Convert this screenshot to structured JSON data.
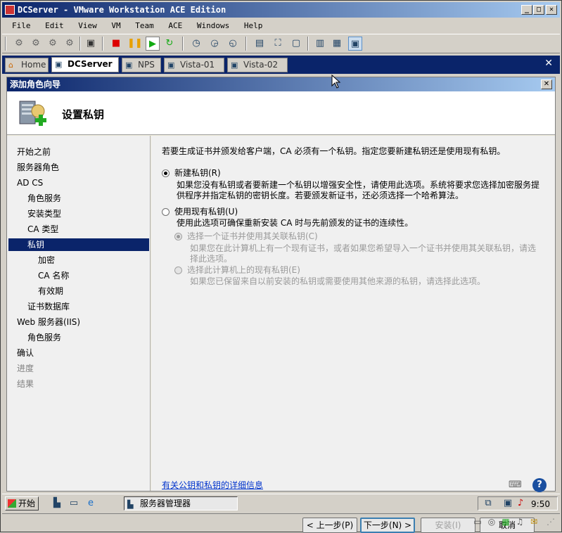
{
  "window": {
    "title": "DCServer - VMware Workstation ACE Edition",
    "minimize": "_",
    "maximize": "□",
    "close": "✕"
  },
  "menu": [
    "File",
    "Edit",
    "View",
    "VM",
    "Team",
    "ACE",
    "Windows",
    "Help"
  ],
  "tabs": [
    {
      "label": "Home",
      "icon": "home-icon"
    },
    {
      "label": "DCServer",
      "icon": "vm-icon",
      "active": true
    },
    {
      "label": "NPS",
      "icon": "vm-icon"
    },
    {
      "label": "Vista-01",
      "icon": "vm-icon"
    },
    {
      "label": "Vista-02",
      "icon": "vm-icon"
    }
  ],
  "tabs_close": "✕",
  "dialog": {
    "title": "添加角色向导",
    "close": "✕",
    "heading": "设置私钥",
    "nav": [
      {
        "label": "开始之前",
        "level": 0,
        "state": "normal"
      },
      {
        "label": "服务器角色",
        "level": 0,
        "state": "normal"
      },
      {
        "label": "AD CS",
        "level": 0,
        "state": "normal"
      },
      {
        "label": "角色服务",
        "level": 1,
        "state": "normal"
      },
      {
        "label": "安装类型",
        "level": 1,
        "state": "normal"
      },
      {
        "label": "CA 类型",
        "level": 1,
        "state": "normal"
      },
      {
        "label": "私钥",
        "level": 1,
        "state": "selected"
      },
      {
        "label": "加密",
        "level": 2,
        "state": "normal"
      },
      {
        "label": "CA 名称",
        "level": 2,
        "state": "normal"
      },
      {
        "label": "有效期",
        "level": 2,
        "state": "normal"
      },
      {
        "label": "证书数据库",
        "level": 1,
        "state": "normal"
      },
      {
        "label": "Web 服务器(IIS)",
        "level": 0,
        "state": "normal"
      },
      {
        "label": "角色服务",
        "level": 1,
        "state": "normal"
      },
      {
        "label": "确认",
        "level": 0,
        "state": "normal"
      },
      {
        "label": "进度",
        "level": 0,
        "state": "disabled"
      },
      {
        "label": "结果",
        "level": 0,
        "state": "disabled"
      }
    ],
    "intro": "若要生成证书并颁发给客户端，CA 必须有一个私钥。指定您要新建私钥还是使用现有私钥。",
    "opt_new_label": "新建私钥(R)",
    "opt_new_desc_1": "如果您没有私钥或者要新建一个私钥以增强安全性，请使用此选项。系统将要求您选择加密服务提",
    "opt_new_desc_2": "供程序并指定私钥的密钥长度。若要颁发新证书，还必须选择一个哈希算法。",
    "opt_existing_label": "使用现有私钥(U)",
    "opt_existing_desc": "使用此选项可确保重新安装 CA 时与先前颁发的证书的连续性。",
    "sub_cert_label": "选择一个证书并使用其关联私钥(C)",
    "sub_cert_desc_1": "如果您在此计算机上有一个现有证书，或者如果您希望导入一个证书并使用其关联私钥，请选",
    "sub_cert_desc_2": "择此选项。",
    "sub_key_label": "选择此计算机上的现有私钥(E)",
    "sub_key_desc": "如果您已保留来自以前安装的私钥或需要使用其他来源的私钥，请选择此选项。",
    "link": "有关公钥和私钥的详细信息",
    "btn_prev": "< 上一步(P)",
    "btn_next": "下一步(N) >",
    "btn_install": "安装(I)",
    "btn_cancel": "取消"
  },
  "taskbar": {
    "start": "开始",
    "task": "服务器管理器",
    "clock": "9:50"
  },
  "help": "?"
}
